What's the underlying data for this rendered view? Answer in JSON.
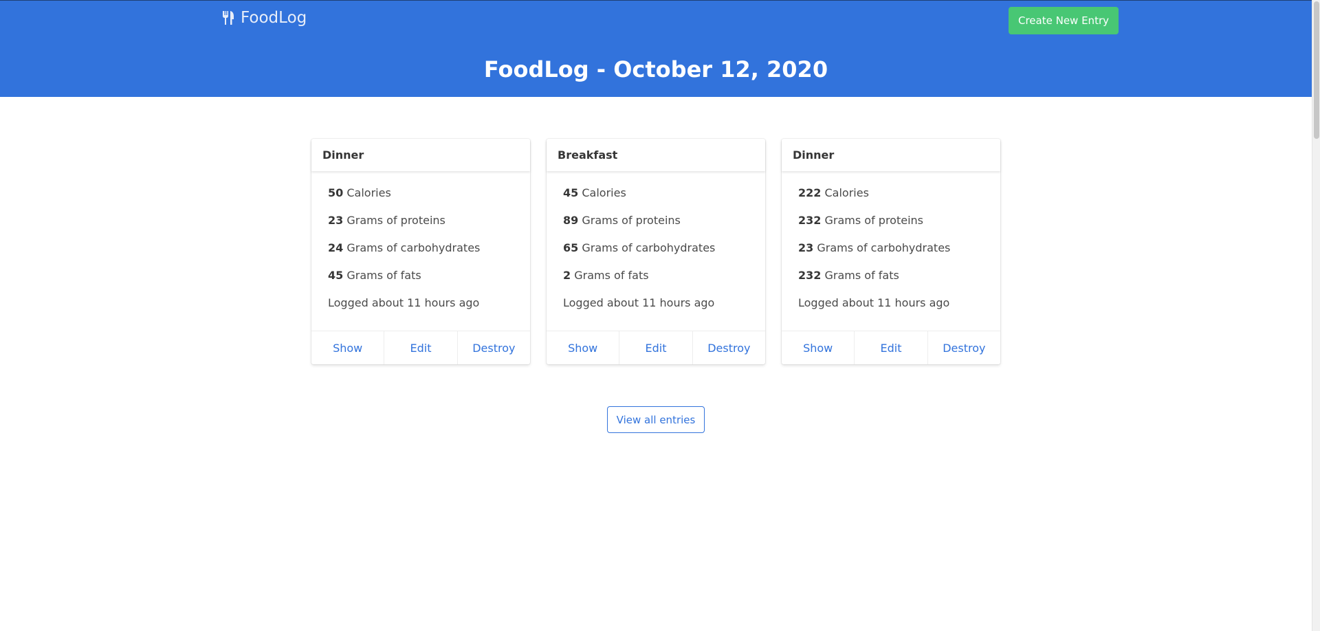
{
  "colors": {
    "hero_bg": "#3273dc",
    "create_button_bg": "#48c774",
    "link": "#3273dc"
  },
  "navbar": {
    "brand_icon": "utensils-icon",
    "brand_text": "FoodLog",
    "create_button_label": "Create New Entry"
  },
  "hero": {
    "title": "FoodLog - October 12, 2020"
  },
  "entries": [
    {
      "meal": "Dinner",
      "calories": "50",
      "calories_label": "Calories",
      "proteins": "23",
      "proteins_label": "Grams of proteins",
      "carbohydrates": "24",
      "carbohydrates_label": "Grams of carbohydrates",
      "fats": "45",
      "fats_label": "Grams of fats",
      "logged": "Logged about 11 hours ago",
      "actions": {
        "show": "Show",
        "edit": "Edit",
        "destroy": "Destroy"
      }
    },
    {
      "meal": "Breakfast",
      "calories": "45",
      "calories_label": "Calories",
      "proteins": "89",
      "proteins_label": "Grams of proteins",
      "carbohydrates": "65",
      "carbohydrates_label": "Grams of carbohydrates",
      "fats": "2",
      "fats_label": "Grams of fats",
      "logged": "Logged about 11 hours ago",
      "actions": {
        "show": "Show",
        "edit": "Edit",
        "destroy": "Destroy"
      }
    },
    {
      "meal": "Dinner",
      "calories": "222",
      "calories_label": "Calories",
      "proteins": "232",
      "proteins_label": "Grams of proteins",
      "carbohydrates": "23",
      "carbohydrates_label": "Grams of carbohydrates",
      "fats": "232",
      "fats_label": "Grams of fats",
      "logged": "Logged about 11 hours ago",
      "actions": {
        "show": "Show",
        "edit": "Edit",
        "destroy": "Destroy"
      }
    }
  ],
  "view_all_label": "View all entries"
}
